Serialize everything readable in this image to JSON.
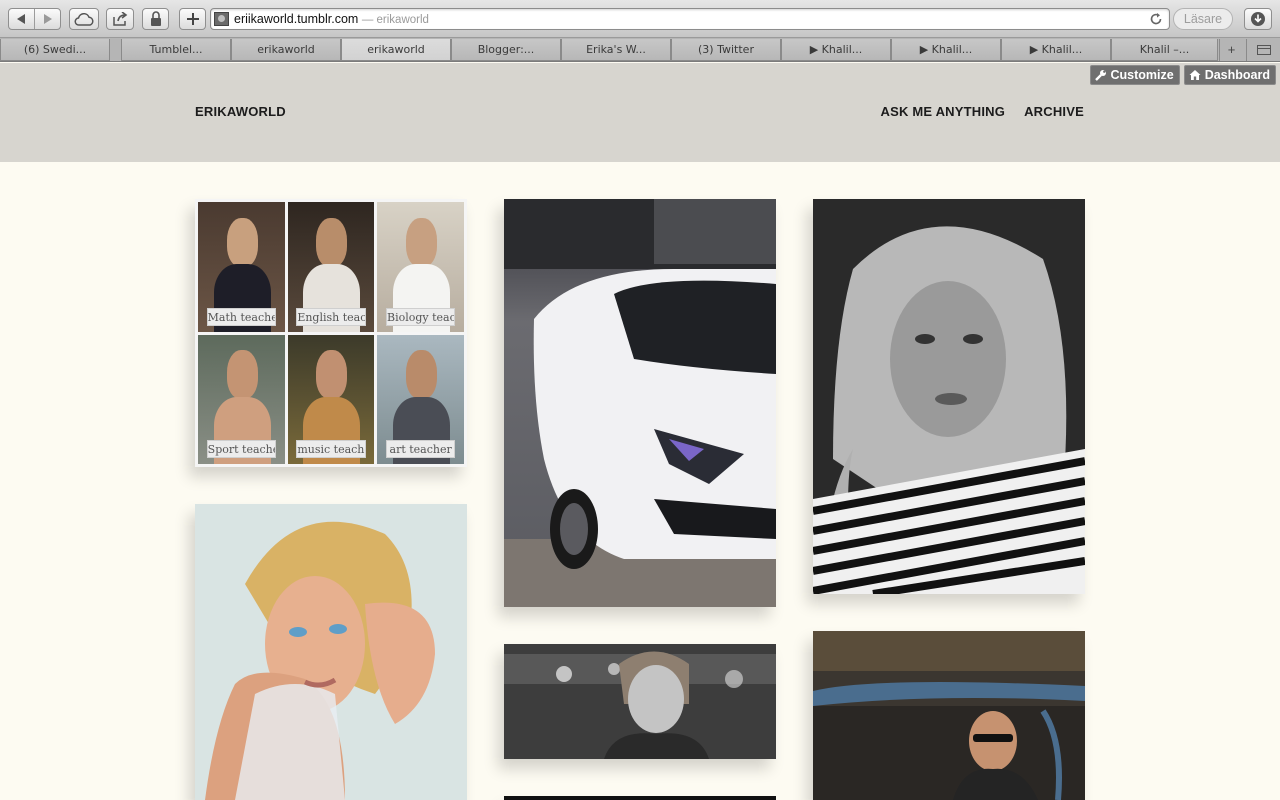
{
  "browser": {
    "url_domain": "eriikaworld.tumblr.com",
    "url_title": "— erikaworld",
    "reader_label": "Läsare",
    "tabs": [
      {
        "label": "(6) Swedi..."
      },
      {
        "label": "Tumblel..."
      },
      {
        "label": "erikaworld"
      },
      {
        "label": "erikaworld"
      },
      {
        "label": "Blogger:..."
      },
      {
        "label": "Erika's W..."
      },
      {
        "label": "(3) Twitter"
      },
      {
        "label": "▶ Khalil..."
      },
      {
        "label": "▶ Khalil..."
      },
      {
        "label": "▶ Khalil..."
      },
      {
        "label": "Khalil –..."
      }
    ],
    "new_tab_label": "+"
  },
  "tumblr_controls": {
    "customize_label": "Customize",
    "dashboard_label": "Dashboard"
  },
  "blog": {
    "title": "ERIKAWORLD",
    "nav": {
      "ask": "ASK ME ANYTHING",
      "archive": "ARCHIVE"
    }
  },
  "posts": {
    "collage_labels": [
      "Math teacher",
      "English teacher",
      "Biology teacher",
      "Sport teacher",
      "music teacher",
      "art teacher"
    ]
  },
  "colors": {
    "page_bg": "#fdfbf2",
    "header_bg": "#d7d5cf",
    "tumblr_button_bg": "#6f6f6f"
  }
}
